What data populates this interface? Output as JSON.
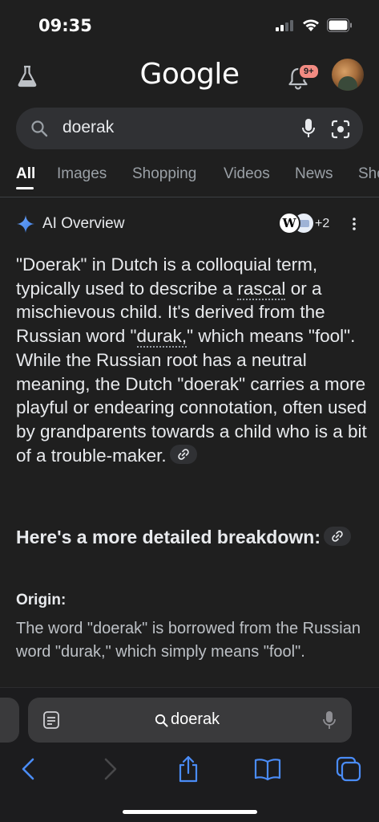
{
  "status_bar": {
    "time": "09:35"
  },
  "header": {
    "logo": "Google",
    "notification_badge": "9+",
    "icons": [
      "labs-flask-icon",
      "bell-icon",
      "avatar"
    ]
  },
  "search": {
    "query": "doerak",
    "icons": [
      "search-icon",
      "mic-icon",
      "lens-icon"
    ]
  },
  "tabs": [
    {
      "label": "All",
      "active": true
    },
    {
      "label": "Images"
    },
    {
      "label": "Shopping"
    },
    {
      "label": "Videos"
    },
    {
      "label": "News"
    },
    {
      "label": "Sho"
    }
  ],
  "ai_overview": {
    "title": "AI Overview",
    "source_count": "+2",
    "source_icon_letter": "W",
    "paragraph": {
      "p1": "\"Doerak\" in Dutch is a colloquial term, typically used to describe a ",
      "rascal": "rascal",
      "p2": " or a mischievous child. It's derived from the Russian word \"",
      "durak": "durak,",
      "p3": "\" which means \"fool\". While the Russian root has a neutral meaning, the Dutch \"doerak\" carries a more playful or endearing connotation, often used by grandparents towards a child who is a bit of a trouble-maker."
    },
    "subheading": "Here's a more detailed breakdown:",
    "origin_label": "Origin:",
    "origin_text": "The word \"doerak\" is borrowed from the Russian word \"durak,\" which simply means \"fool\"."
  },
  "browser_bar": {
    "address": "doerak",
    "icons": [
      "reader-icon",
      "search-icon",
      "mic-icon",
      "back-icon",
      "forward-icon",
      "share-icon",
      "bookmarks-icon",
      "tabs-icon"
    ]
  },
  "colors": {
    "background": "#1f1f1f",
    "accent_blue": "#4a8cf7",
    "badge": "#f28b82",
    "search_bg": "#303134"
  }
}
